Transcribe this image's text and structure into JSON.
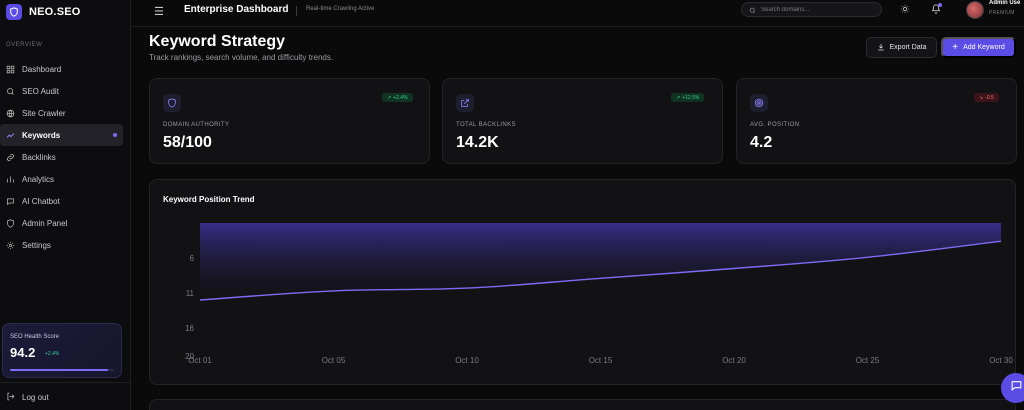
{
  "brand": {
    "name": "NEO.SEO"
  },
  "sidebar": {
    "section_label": "OVERVIEW",
    "items": [
      {
        "label": "Dashboard",
        "icon": "grid-icon",
        "active": false
      },
      {
        "label": "SEO Audit",
        "icon": "search-icon",
        "active": false
      },
      {
        "label": "Site Crawler",
        "icon": "globe-icon",
        "active": false
      },
      {
        "label": "Keywords",
        "icon": "trending-icon",
        "active": true
      },
      {
        "label": "Backlinks",
        "icon": "link-icon",
        "active": false
      },
      {
        "label": "Analytics",
        "icon": "bar-chart-icon",
        "active": false
      },
      {
        "label": "AI Chatbot",
        "icon": "chat-icon",
        "active": false
      },
      {
        "label": "Admin Panel",
        "icon": "shield-icon",
        "active": false
      },
      {
        "label": "Settings",
        "icon": "gear-icon",
        "active": false
      }
    ],
    "health": {
      "title": "SEO Health Score",
      "score": "94.2",
      "delta": "+2.4%",
      "progress": 0.942
    },
    "logout_label": "Log out"
  },
  "header": {
    "title": "Enterprise Dashboard",
    "status": "Real-time Crawling Active",
    "search_placeholder": "Search domains...",
    "user_name": "Admin Use",
    "user_tier": "PREMIUM"
  },
  "main": {
    "title": "Keyword Strategy",
    "subtitle": "Track rankings, search volume, and difficulty trends.",
    "export_label": "Export Data",
    "add_label": "Add Keyword"
  },
  "stats": [
    {
      "label": "DOMAIN AUTHORITY",
      "value": "58/100",
      "delta": "+2.4%",
      "trend": "up",
      "icon": "shield-icon"
    },
    {
      "label": "TOTAL BACKLINKS",
      "value": "14.2K",
      "delta": "+12.5%",
      "trend": "up",
      "icon": "external-link-icon"
    },
    {
      "label": "AVG. POSITION",
      "value": "4.2",
      "delta": "-0.5",
      "trend": "down",
      "icon": "target-icon"
    }
  ],
  "colors": {
    "accent": "#5b4ce6",
    "line": "#7c6cf5",
    "up": "#34d399",
    "down": "#f87171"
  },
  "chart_data": {
    "type": "area",
    "title": "Keyword Position Trend",
    "x": [
      "Oct 01",
      "Oct 05",
      "Oct 10",
      "Oct 15",
      "Oct 20",
      "Oct 25",
      "Oct 30"
    ],
    "series": [
      {
        "values": [
          12,
          10.7,
          10.3,
          8.9,
          7.5,
          5.9,
          3.6
        ]
      }
    ],
    "y_ticks": [
      6,
      11,
      16,
      20
    ],
    "ylim": [
      1,
      20
    ],
    "y_inverted": true,
    "grid": false
  }
}
